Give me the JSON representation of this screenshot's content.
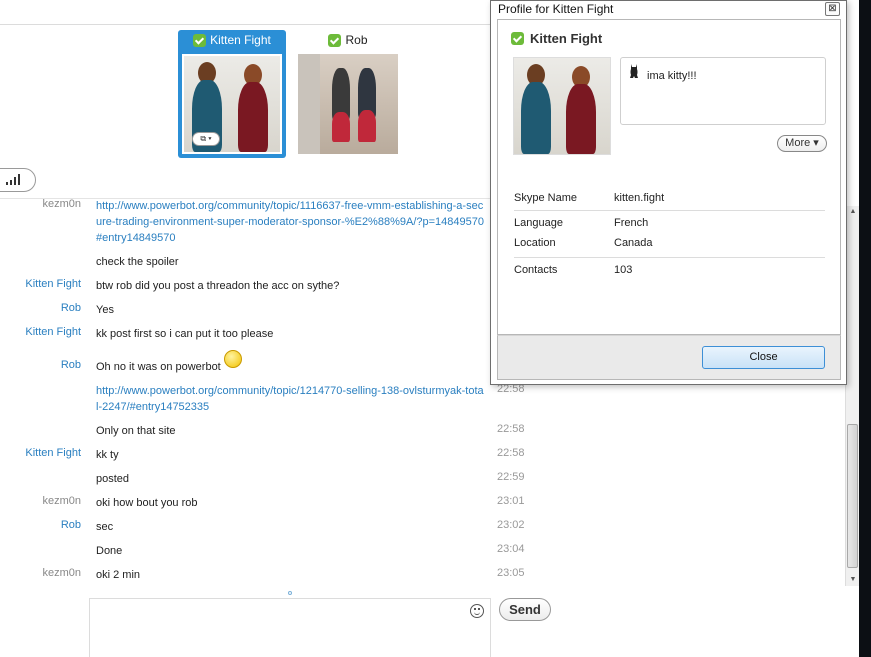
{
  "participants": [
    {
      "name": "Kitten Fight",
      "selected": true
    },
    {
      "name": "Rob",
      "selected": false
    }
  ],
  "video_button_label": "⧉ ▾",
  "messages": [
    {
      "sender": "kezm0n",
      "text": "http://www.powerbot.org/community/topic/1116637-free-vmm-establishing-a-secure-trading-environment-super-moderator-sponsor-%E2%88%9A/?p=14849570#entry14849570",
      "time": "",
      "kind": "link"
    },
    {
      "sender": "",
      "text": "check the spoiler",
      "time": "",
      "kind": "text"
    },
    {
      "sender": "Kitten Fight",
      "text": "btw rob did you post a threadon the acc on sythe?",
      "time": "",
      "kind": "text"
    },
    {
      "sender": "Rob",
      "text": "Yes",
      "time": "",
      "kind": "text"
    },
    {
      "sender": "Kitten Fight",
      "text": "kk post first so i can put it too please",
      "time": "",
      "kind": "text"
    },
    {
      "sender": "Rob",
      "text": "Oh no it was on powerbot",
      "time": "",
      "kind": "text"
    },
    {
      "sender": "",
      "text": "http://www.powerbot.org/community/topic/1214770-selling-138-ovlsturmyak-total-2247/#entry14752335",
      "time": "22:58",
      "kind": "link"
    },
    {
      "sender": "",
      "text": "Only on that site",
      "time": "22:58",
      "kind": "text"
    },
    {
      "sender": "Kitten Fight",
      "text": "kk ty",
      "time": "22:58",
      "kind": "text"
    },
    {
      "sender": "",
      "text": "posted",
      "time": "22:59",
      "kind": "text"
    },
    {
      "sender": "kezm0n",
      "text": "oki how bout you rob",
      "time": "23:01",
      "kind": "text"
    },
    {
      "sender": "Rob",
      "text": "sec",
      "time": "23:02",
      "kind": "text"
    },
    {
      "sender": "",
      "text": "Done",
      "time": "23:04",
      "kind": "text"
    },
    {
      "sender": "kezm0n",
      "text": "oki 2 min",
      "time": "23:05",
      "kind": "text"
    }
  ],
  "composer": {
    "value": "",
    "send_label": "Send"
  },
  "profile": {
    "window_title": "Profile for Kitten Fight",
    "close_glyph": "⊠",
    "name": "Kitten Fight",
    "mood": "ima kitty!!!",
    "more_label": "More ▾",
    "fields": {
      "skype_name_label": "Skype Name",
      "skype_name": "kitten.fight",
      "language_label": "Language",
      "language": "French",
      "location_label": "Location",
      "location": "Canada",
      "contacts_label": "Contacts",
      "contacts": "103"
    },
    "close_button_label": "Close"
  },
  "colors": {
    "accent": "#2b8fd6",
    "link": "#2a7fc0",
    "online": "#6dbb3a"
  }
}
